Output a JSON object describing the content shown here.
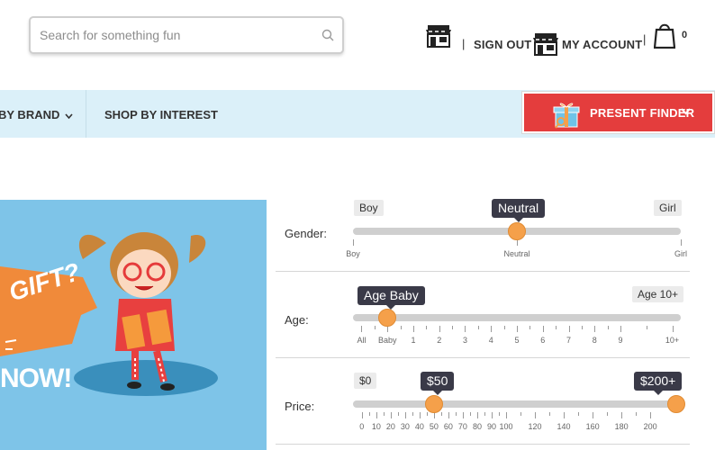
{
  "header": {
    "search_placeholder": "Search for something fun",
    "sign_out": "SIGN OUT",
    "my_account": "MY ACCOUNT",
    "separator": "|",
    "cart_count": "0"
  },
  "nav": {
    "items": [
      {
        "label": "BY BRAND"
      },
      {
        "label": "SHOP BY INTEREST"
      }
    ],
    "present_finder": "PRESENT FINDER"
  },
  "hero": {
    "line1": "GIFT?",
    "line2": "NOW!"
  },
  "colors": {
    "nav_bg": "#dbf0f9",
    "present_btn": "#e43d3d",
    "hero_bg": "#7ec4e8",
    "handle": "#f5a04a",
    "tooltip": "#3a3a48"
  },
  "sliders": {
    "gender": {
      "label": "Gender:",
      "min_label": "Boy",
      "max_label": "Girl",
      "value_label": "Neutral",
      "value_fraction": 0.5,
      "ticks": [
        {
          "label": "Boy",
          "pos": 0
        },
        {
          "label": "Neutral",
          "pos": 0.5
        },
        {
          "label": "Girl",
          "pos": 1
        }
      ],
      "minor_ticks": 0
    },
    "age": {
      "label": "Age:",
      "min_label": "Age Baby",
      "max_label": "Age 10+",
      "value_label": "Age Baby",
      "value_fraction": 0.105,
      "ticks": [
        {
          "label": "All",
          "pos": 0.026
        },
        {
          "label": "Baby",
          "pos": 0.105
        },
        {
          "label": "1",
          "pos": 0.184
        },
        {
          "label": "2",
          "pos": 0.263
        },
        {
          "label": "3",
          "pos": 0.342
        },
        {
          "label": "4",
          "pos": 0.421
        },
        {
          "label": "5",
          "pos": 0.5
        },
        {
          "label": "6",
          "pos": 0.579
        },
        {
          "label": "7",
          "pos": 0.658
        },
        {
          "label": "8",
          "pos": 0.737
        },
        {
          "label": "9",
          "pos": 0.816
        },
        {
          "label": "10+",
          "pos": 0.974
        }
      ],
      "minor_ticks": 1
    },
    "price": {
      "label": "Price:",
      "min_label": "$0",
      "low_value_label": "$50",
      "high_value_label": "$200+",
      "low_fraction": 0.247,
      "high_fraction": 0.986,
      "ticks": [
        {
          "label": "0",
          "pos": 0.027
        },
        {
          "label": "10",
          "pos": 0.071
        },
        {
          "label": "20",
          "pos": 0.115
        },
        {
          "label": "30",
          "pos": 0.159
        },
        {
          "label": "40",
          "pos": 0.203
        },
        {
          "label": "50",
          "pos": 0.247
        },
        {
          "label": "60",
          "pos": 0.291
        },
        {
          "label": "70",
          "pos": 0.335
        },
        {
          "label": "80",
          "pos": 0.379
        },
        {
          "label": "90",
          "pos": 0.423
        },
        {
          "label": "100",
          "pos": 0.467
        },
        {
          "label": "120",
          "pos": 0.555
        },
        {
          "label": "140",
          "pos": 0.643
        },
        {
          "label": "160",
          "pos": 0.731
        },
        {
          "label": "180",
          "pos": 0.819
        },
        {
          "label": "200",
          "pos": 0.907
        }
      ],
      "minor_ticks": 1
    }
  }
}
